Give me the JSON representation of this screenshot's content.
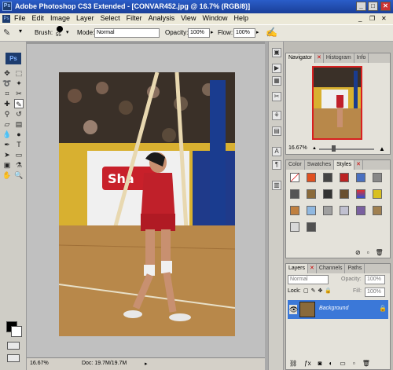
{
  "window": {
    "app_badge": "Ps",
    "title": "Adobe Photoshop CS3 Extended - [CONVAR452.jpg @ 16.7% (RGB/8)]",
    "min": "_",
    "max": "□",
    "close": "✕"
  },
  "menu": [
    "File",
    "Edit",
    "Image",
    "Layer",
    "Select",
    "Filter",
    "Analysis",
    "View",
    "Window",
    "Help"
  ],
  "options": {
    "brush_label": "Brush:",
    "brush_size": "55",
    "mode_label": "Mode:",
    "mode_value": "Normal",
    "opacity_label": "Opacity:",
    "opacity_value": "100%",
    "flow_label": "Flow:",
    "flow_value": "100%"
  },
  "toolbox": {
    "badge": "Ps"
  },
  "status": {
    "zoom": "16.67%",
    "doc": "Doc: 19.7M/19.7M"
  },
  "navigator": {
    "tabs": [
      "Navigator",
      "Histogram",
      "Info"
    ],
    "zoom": "16.67%"
  },
  "color_panel": {
    "tabs": [
      "Color",
      "Swatches",
      "Styles"
    ]
  },
  "layers_panel": {
    "tabs": [
      "Layers",
      "Channels",
      "Paths"
    ],
    "mode": "Normal",
    "opacity_label": "Opacity:",
    "opacity_value": "100%",
    "lock_label": "Lock:",
    "fill_label": "Fill:",
    "fill_value": "100%",
    "layer_name": "Background"
  },
  "colors": {
    "accent": "#2a5dc8",
    "layer_selected": "#3b78d8"
  }
}
